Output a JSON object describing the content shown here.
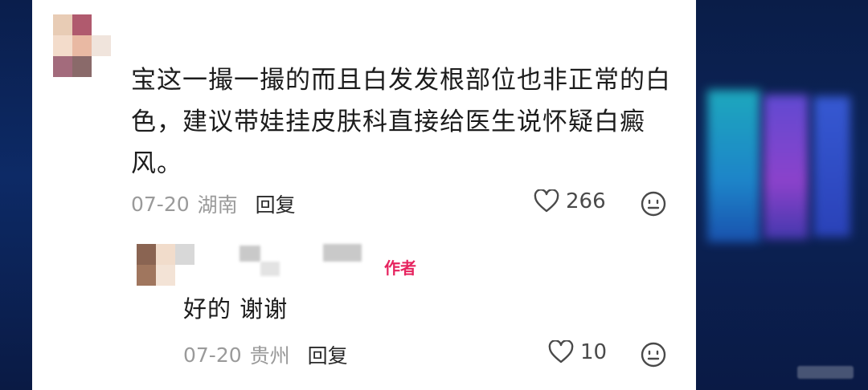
{
  "comment": {
    "text": "宝这一撮一撮的而且白发发根部位也非正常的白色，建议带娃挂皮肤科直接给医生说怀疑白癜风。",
    "date": "07-20",
    "location": "湖南",
    "reply_label": "回复",
    "likes": "266"
  },
  "reply": {
    "author_badge": "作者",
    "text": "好的 谢谢",
    "date": "07-20",
    "location": "贵州",
    "reply_label": "回复",
    "likes": "10"
  },
  "colors": {
    "accent": "#e6245f",
    "meta_gray": "#9a9a9a",
    "background": "#0b1f4a"
  },
  "icons": [
    "heart-icon",
    "smiley-face-icon"
  ]
}
